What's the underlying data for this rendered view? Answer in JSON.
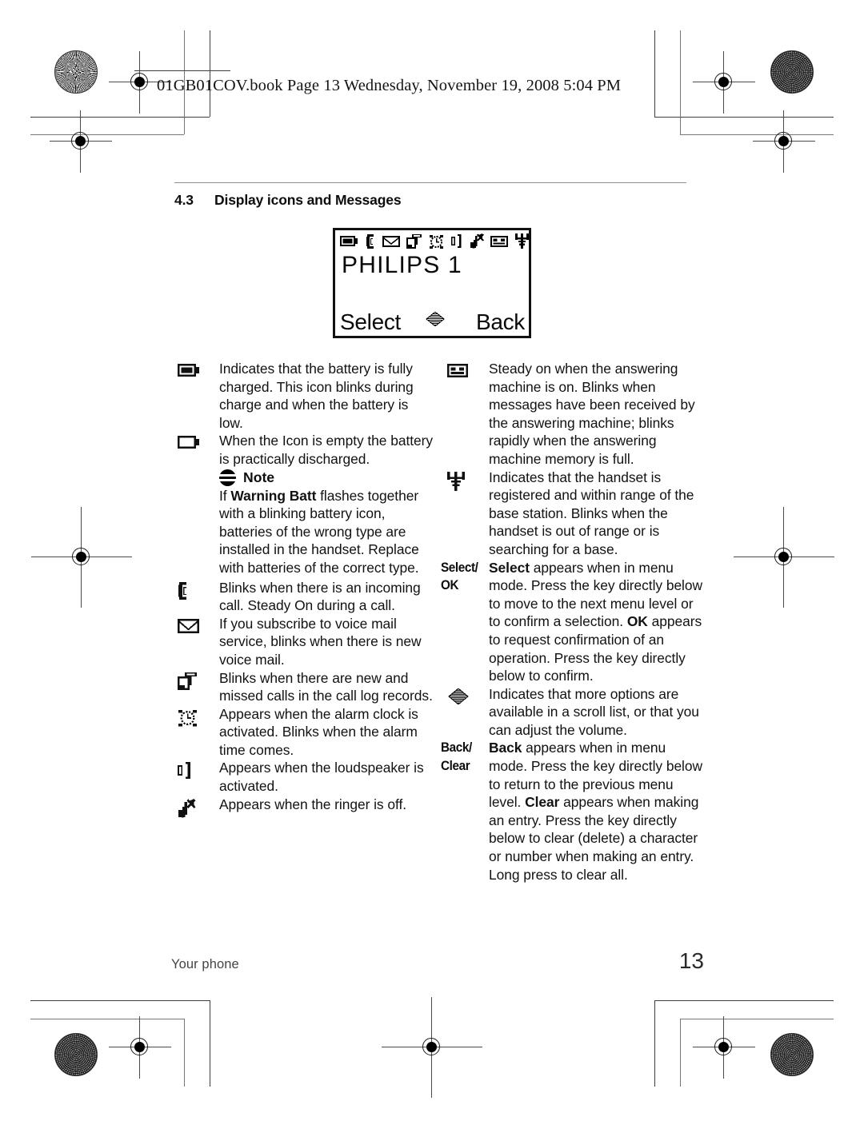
{
  "print_header": {
    "text": "01GB01COV.book  Page 13  Wednesday, November 19, 2008  5:04 PM"
  },
  "section": {
    "number": "4.3",
    "title": "Display icons and Messages"
  },
  "lcd": {
    "status_icons": [
      "battery-icon",
      "phone-handset-icon",
      "envelope-voicemail-icon",
      "call-log-icon",
      "alarm-clock-icon",
      "loudspeaker-icon",
      "ringer-off-icon",
      "answering-machine-icon",
      "antenna-signal-icon"
    ],
    "title_text": "PHILIPS 1",
    "softkey_left": "Select",
    "softkey_right": "Back",
    "scroll_indicator": "scroll-diamond-icon"
  },
  "left_column": [
    {
      "icon": "battery-full-icon",
      "text": "Indicates that the battery is fully charged. This icon blinks during charge and when the battery is low."
    },
    {
      "icon": "battery-empty-icon",
      "text": "When the Icon is empty the battery is practically discharged."
    },
    {
      "icon": "phone-handset-icon",
      "text": "Blinks when there is an incoming call. Steady On during a call."
    },
    {
      "icon": "envelope-voicemail-icon",
      "text": "If you subscribe to voice mail service, blinks when there is new voice mail."
    },
    {
      "icon": "call-log-icon",
      "text": "Blinks when there are new and missed calls in the call log records."
    },
    {
      "icon": "alarm-clock-icon",
      "text": "Appears when the alarm clock is activated. Blinks when the alarm time comes."
    },
    {
      "icon": "loudspeaker-icon",
      "text": "Appears when the loudspeaker is activated."
    },
    {
      "icon": "ringer-off-icon",
      "text": "Appears when the ringer is off."
    }
  ],
  "note": {
    "icon": "note-icon",
    "title": "Note",
    "body_prefix": "If ",
    "body_bold": "Warning Batt",
    "body_suffix": " flashes together with a blinking battery icon, batteries of the wrong type are installed in the handset. Replace with batteries of the correct type."
  },
  "right_column": [
    {
      "icon": "answering-machine-icon",
      "key": "",
      "text": "Steady on when the answering machine is on. Blinks when messages have been received by the answering machine; blinks rapidly when the answering machine memory is full."
    },
    {
      "icon": "antenna-signal-icon",
      "key": "",
      "text": "Indicates that the handset is registered and within range of the base station. Blinks when the handset is out of range or is searching for a base."
    },
    {
      "icon": "",
      "key": "Select/\nOK",
      "key_line1": "Select/",
      "key_line2": "OK",
      "bold_lead": "Select",
      "text": " appears when in menu mode. Press the key directly below to move to the next menu level or to confirm a selection.",
      "bold_lead2": "OK",
      "text2": " appears to request confirmation of an operation. Press the key directly below to confirm."
    },
    {
      "icon": "scroll-diamond-icon",
      "key": "",
      "text": "Indicates that more options are available in a scroll list, or that you can adjust the volume."
    },
    {
      "icon": "",
      "key_line1": "Back/",
      "key_line2": "Clear",
      "bold_lead": "Back",
      "text": " appears when in menu mode. Press the key directly below to return to the previous menu level.",
      "bold_lead2": "Clear",
      "text2": " appears when making an entry. Press the key directly below to clear (delete) a character or number when making an entry. Long press to clear all."
    }
  ],
  "footer": {
    "label": "Your phone",
    "page_number": "13"
  },
  "colors": {
    "text": "#121212",
    "rule": "#8d8d8d",
    "lcd_border": "#111111"
  }
}
